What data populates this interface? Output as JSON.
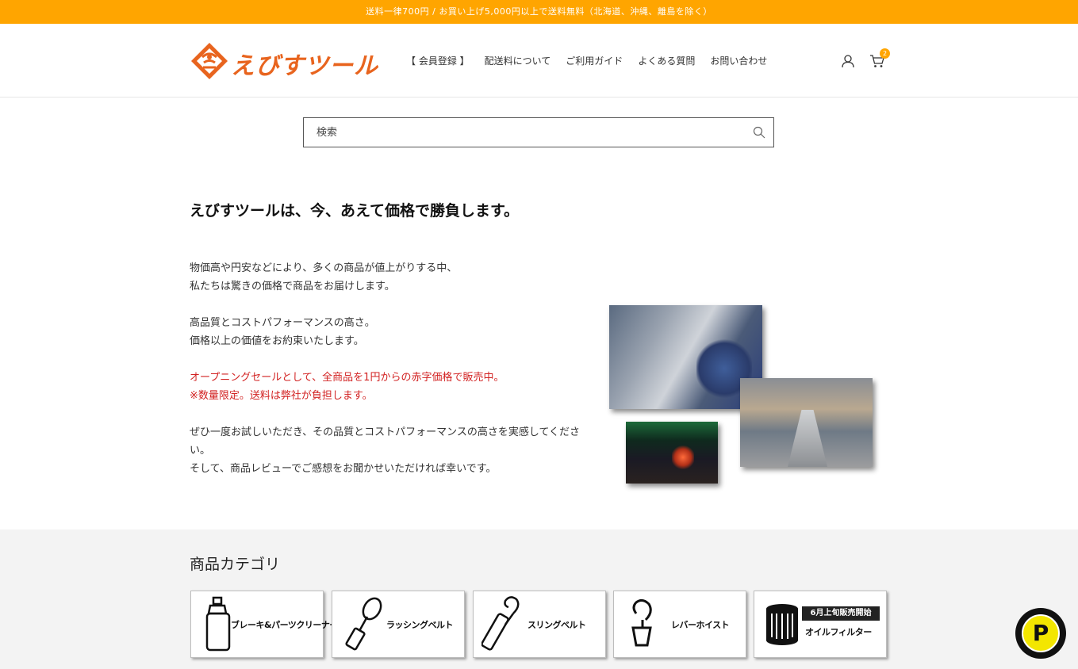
{
  "announcement": "送料一律700円 / お買い上げ5,000円以上で送料無料（北海道、沖縄、離島を除く）",
  "brand": {
    "name": "えびすツール",
    "color": "#e8641e"
  },
  "nav": [
    {
      "label": "【 会員登録 】"
    },
    {
      "label": "配送料について"
    },
    {
      "label": "ご利用ガイド"
    },
    {
      "label": "よくある質問"
    },
    {
      "label": "お問い合わせ"
    }
  ],
  "header_icons": {
    "account": "user-icon",
    "cart": "cart-icon",
    "cart_count": "2"
  },
  "search": {
    "placeholder": "検索"
  },
  "hero": {
    "headline": "えびすツールは、今、あえて価格で勝負します。",
    "lines": {
      "l1": "物価高や円安などにより、多くの商品が値上がりする中、",
      "l2": "私たちは驚きの価格で商品をお届けします。",
      "l3": "高品質とコストパフォーマンスの高さ。",
      "l4": "価格以上の価値をお約束いたします。",
      "l5": "オープニングセールとして、全商品を1円からの赤字価格で販売中。",
      "l6": "※数量限定。送料は弊社が負担します。",
      "l7": "ぜひ一度お試しいただき、その品質とコストパフォーマンスの高さを実感してください。",
      "l8": "そして、商品レビューでご感想をお聞かせいただければ幸いです。"
    }
  },
  "categories": {
    "title": "商品カテゴリ",
    "items": [
      {
        "label": "ブレーキ&パーツクリーナー",
        "icon": "spray-can-icon"
      },
      {
        "label": "ラッシングベルト",
        "icon": "lashing-belt-icon"
      },
      {
        "label": "スリングベルト",
        "icon": "sling-belt-icon"
      },
      {
        "label": "レバーホイスト",
        "icon": "hook-icon"
      },
      {
        "label": "オイルフィルター",
        "icon": "oil-filter-icon",
        "badge": "6月上旬販売開始"
      }
    ]
  },
  "floating_badge": {
    "letter": "P"
  },
  "colors": {
    "accent": "#ffa500",
    "sale_text": "#d22222"
  }
}
